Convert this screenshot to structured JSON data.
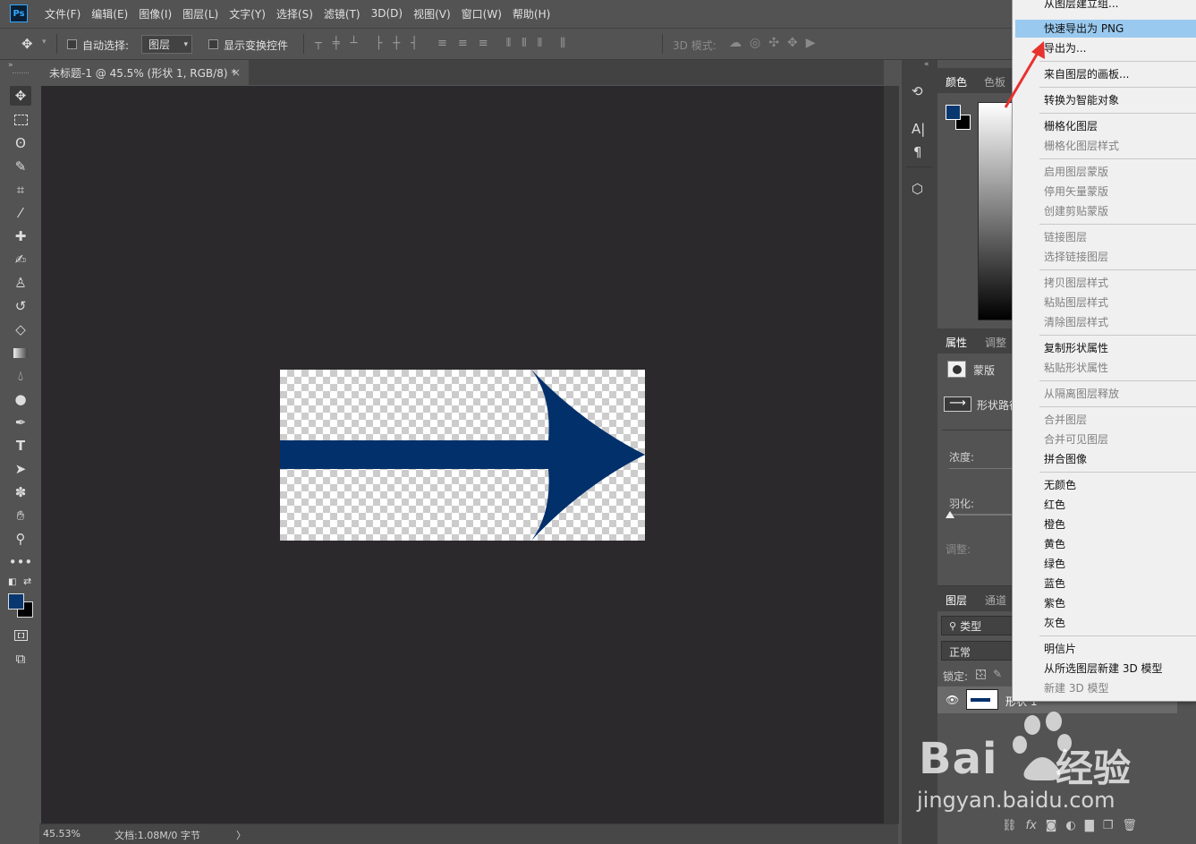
{
  "app": {
    "logo": "Ps"
  },
  "menubar": {
    "items": [
      "文件(F)",
      "编辑(E)",
      "图像(I)",
      "图层(L)",
      "文字(Y)",
      "选择(S)",
      "滤镜(T)",
      "3D(D)",
      "视图(V)",
      "窗口(W)",
      "帮助(H)"
    ]
  },
  "options": {
    "auto_select_label": "自动选择:",
    "auto_select_target": "图层",
    "show_transform_label": "显示变换控件",
    "mode_3d_label": "3D 模式:"
  },
  "document": {
    "tab_title": "未标题-1 @ 45.5% (形状 1, RGB/8) *",
    "close_glyph": "×"
  },
  "colors": {
    "foreground": "#08386f",
    "background": "#000000",
    "shape": "#02306b",
    "highlight": "#99c9ef",
    "menu_bg": "#f0f0f0",
    "canvas_bg": "#2b292c",
    "arrow_red": "#e8322e"
  },
  "status": {
    "zoom": "45.53%",
    "doc_info": "文档:1.08M/0 字节",
    "arrow": "〉"
  },
  "panels": {
    "color_tabs": [
      "颜色",
      "色板"
    ],
    "props_tabs": [
      "属性",
      "调整"
    ],
    "props_mask_label": "蒙版",
    "props_shape_label": "形状路径",
    "density_label": "浓度:",
    "feather_label": "羽化:",
    "adjust_label": "调整:",
    "layers_tabs": [
      "图层",
      "通道"
    ],
    "layer_filter": "类型",
    "blend_mode": "正常",
    "lock_label": "锁定:",
    "layer_name": "形状 1",
    "layer_btn_fx": "fx"
  },
  "context_menu": {
    "items": [
      {
        "label": "从图层建立组...",
        "disabled": false
      },
      {
        "label": "快速导出为 PNG",
        "disabled": false,
        "highlighted": true
      },
      {
        "label": "导出为...",
        "disabled": false
      },
      {
        "label": "来自图层的画板...",
        "disabled": false
      },
      {
        "label": "转换为智能对象",
        "disabled": false
      },
      {
        "label": "栅格化图层",
        "disabled": false
      },
      {
        "label": "栅格化图层样式",
        "disabled": true
      },
      {
        "label": "启用图层蒙版",
        "disabled": true
      },
      {
        "label": "停用矢量蒙版",
        "disabled": true
      },
      {
        "label": "创建剪贴蒙版",
        "disabled": true
      },
      {
        "label": "链接图层",
        "disabled": true
      },
      {
        "label": "选择链接图层",
        "disabled": true
      },
      {
        "label": "拷贝图层样式",
        "disabled": true
      },
      {
        "label": "粘贴图层样式",
        "disabled": true
      },
      {
        "label": "清除图层样式",
        "disabled": true
      },
      {
        "label": "复制形状属性",
        "disabled": false
      },
      {
        "label": "粘贴形状属性",
        "disabled": true
      },
      {
        "label": "从隔离图层释放",
        "disabled": true
      },
      {
        "label": "合并图层",
        "disabled": true
      },
      {
        "label": "合并可见图层",
        "disabled": true
      },
      {
        "label": "拼合图像",
        "disabled": false
      },
      {
        "label": "无颜色",
        "disabled": false
      },
      {
        "label": "红色",
        "disabled": false
      },
      {
        "label": "橙色",
        "disabled": false
      },
      {
        "label": "黄色",
        "disabled": false
      },
      {
        "label": "绿色",
        "disabled": false
      },
      {
        "label": "蓝色",
        "disabled": false
      },
      {
        "label": "紫色",
        "disabled": false
      },
      {
        "label": "灰色",
        "disabled": false
      },
      {
        "label": "明信片",
        "disabled": false
      },
      {
        "label": "从所选图层新建 3D 模型",
        "disabled": false
      },
      {
        "label": "新建 3D 模型",
        "disabled": true
      }
    ]
  },
  "watermark": {
    "brand_left": "Bai",
    "brand_right": "经验",
    "url": "jingyan.baidu.com"
  }
}
